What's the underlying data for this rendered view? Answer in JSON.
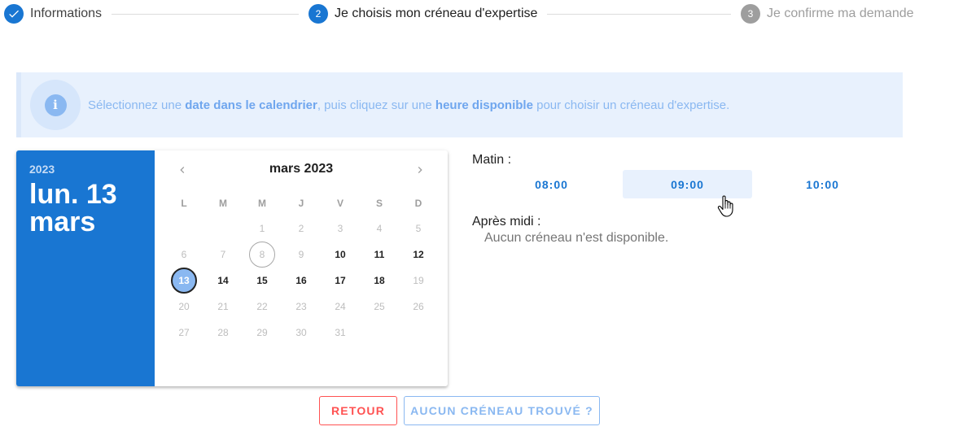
{
  "colors": {
    "primary": "#1976d2",
    "muted": "#9e9e9e",
    "danger": "#ff5252",
    "info": "#8ab8f1"
  },
  "stepper": {
    "steps": [
      {
        "number": "",
        "label": "Informations",
        "state": "completed",
        "icon": "check-icon"
      },
      {
        "number": "2",
        "label": "Je choisis mon créneau d'expertise",
        "state": "active"
      },
      {
        "number": "3",
        "label": "Je confirme ma demande",
        "state": "inactive"
      }
    ]
  },
  "alert": {
    "icon": "info-icon",
    "text_1": "Sélectionnez une ",
    "bold_1": "date dans le calendrier",
    "text_2": ", puis cliquez sur une ",
    "bold_2": "heure disponible",
    "text_3": " pour choisir un créneau d'expertise."
  },
  "date_picker": {
    "year": "2023",
    "selected_date": "lun. 13 mars",
    "month_label": "mars 2023",
    "weekdays": [
      "L",
      "M",
      "M",
      "J",
      "V",
      "S",
      "D"
    ],
    "days": [
      {
        "day": "1",
        "state": "disabled"
      },
      {
        "day": "2",
        "state": "disabled"
      },
      {
        "day": "3",
        "state": "disabled"
      },
      {
        "day": "4",
        "state": "disabled"
      },
      {
        "day": "5",
        "state": "disabled"
      },
      {
        "day": "6",
        "state": "disabled"
      },
      {
        "day": "7",
        "state": "disabled"
      },
      {
        "day": "8",
        "state": "today"
      },
      {
        "day": "9",
        "state": "disabled"
      },
      {
        "day": "10",
        "state": "enabled"
      },
      {
        "day": "11",
        "state": "enabled"
      },
      {
        "day": "12",
        "state": "enabled"
      },
      {
        "day": "13",
        "state": "selected"
      },
      {
        "day": "14",
        "state": "enabled"
      },
      {
        "day": "15",
        "state": "enabled"
      },
      {
        "day": "16",
        "state": "enabled"
      },
      {
        "day": "17",
        "state": "enabled"
      },
      {
        "day": "18",
        "state": "enabled"
      },
      {
        "day": "19",
        "state": "disabled"
      },
      {
        "day": "20",
        "state": "disabled"
      },
      {
        "day": "21",
        "state": "disabled"
      },
      {
        "day": "22",
        "state": "disabled"
      },
      {
        "day": "23",
        "state": "disabled"
      },
      {
        "day": "24",
        "state": "disabled"
      },
      {
        "day": "25",
        "state": "disabled"
      },
      {
        "day": "26",
        "state": "disabled"
      },
      {
        "day": "27",
        "state": "disabled"
      },
      {
        "day": "28",
        "state": "disabled"
      },
      {
        "day": "29",
        "state": "disabled"
      },
      {
        "day": "30",
        "state": "disabled"
      },
      {
        "day": "31",
        "state": "disabled"
      }
    ]
  },
  "slots": {
    "morning_title": "Matin :",
    "morning": [
      "08:00",
      "09:00",
      "10:00"
    ],
    "hovered": "09:00",
    "afternoon_title": "Après midi :",
    "afternoon_empty": "Aucun créneau n'est disponible."
  },
  "actions": {
    "back_label": "RETOUR",
    "none_found_label": "AUCUN CRÉNEAU TROUVÉ ?"
  }
}
